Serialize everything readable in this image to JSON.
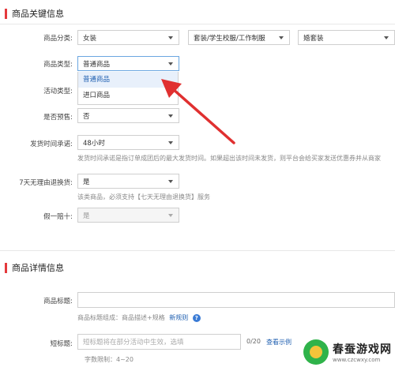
{
  "sections": {
    "key_info_title": "商品关键信息",
    "detail_title": "商品详情信息"
  },
  "category": {
    "label": "商品分类:",
    "level1": "女装",
    "level2": "套装/学生校服/工作制服",
    "level3": "婚套装"
  },
  "product_type": {
    "label": "商品类型:",
    "value": "普通商品",
    "options": [
      "普通商品",
      "进口商品"
    ]
  },
  "activity_type": {
    "label": "活动类型:"
  },
  "presale": {
    "label": "是否预售:",
    "value": "否"
  },
  "shipping": {
    "label": "发货时间承诺:",
    "value": "48小时",
    "hint": "发货时间承诺是指订单成团后的最大发货时间。如果超出该时间未发货，则平台会给买家发送优惠券并从商家"
  },
  "return_policy": {
    "label": "7天无理由退换货:",
    "value": "是",
    "hint": "该类商品，必须支持【七天无理由退换货】服务"
  },
  "fake_compensation": {
    "label": "假一赔十:",
    "value": "是"
  },
  "title_field": {
    "label": "商品标题:",
    "hint_text": "商品标题组成：商品描述+规格",
    "hint_link": "新规则",
    "help_icon": "?"
  },
  "short_title": {
    "label": "短标题:",
    "placeholder": "短标题将在部分活动中生效，选填",
    "counter": "0/20",
    "example_link": "查看示例",
    "limit": "字数限制：4~20"
  },
  "watermark": {
    "name": "春蚕游戏网",
    "url": "www.czcwxy.com"
  },
  "colors": {
    "accent": "#e4393c",
    "link": "#1f5fb0",
    "arrow": "#e03030"
  },
  "icons": [
    "chevron-down-icon",
    "help-icon",
    "arrow-annotation-icon"
  ]
}
